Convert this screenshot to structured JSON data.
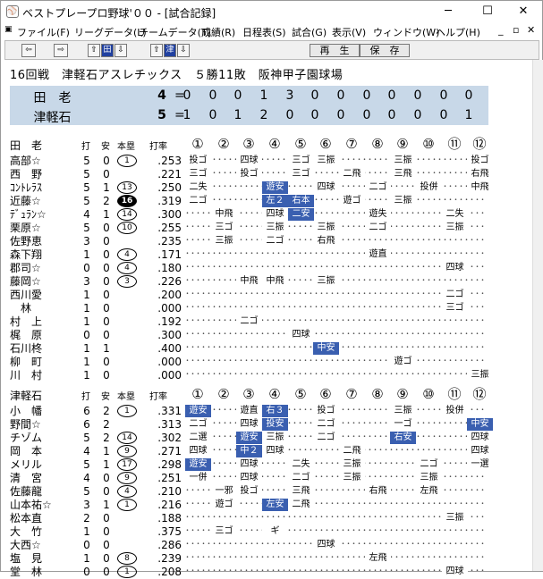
{
  "window": {
    "title": "ベストプレープロ野球'００ - [試合記録]",
    "min": "─",
    "max": "☐",
    "close": "✕",
    "icon": "baseball-icon"
  },
  "menu": {
    "items": [
      "ファイル(F)",
      "リーグデータ(L)",
      "チームデータ(T)",
      "成績(R)",
      "日程表(S)",
      "試合(G)",
      "表示(V)",
      "ウィンドウ(W)",
      "ヘルプ(H)"
    ],
    "mdi": [
      "_",
      "▫",
      "✕"
    ]
  },
  "toolbar": {
    "prev": "⇦",
    "next": "⇨",
    "team_a": "田",
    "team_b": "津",
    "up": "⇧",
    "down": "⇩",
    "replay": "再　生",
    "save": "保　存"
  },
  "game": {
    "title": "16回戦　津軽石アスレチックス　５勝11敗　阪神甲子園球場"
  },
  "scoreboard": {
    "rows": [
      {
        "team": "田　老",
        "total": "4",
        "eq": "=",
        "innings": [
          "0",
          "0",
          "0",
          "1",
          "3",
          "0",
          "0",
          "0",
          "0",
          "0",
          "0",
          "0"
        ]
      },
      {
        "team": "津軽石",
        "total": "5",
        "eq": "=",
        "innings": [
          "1",
          "0",
          "1",
          "2",
          "0",
          "0",
          "0",
          "0",
          "0",
          "0",
          "0",
          "1"
        ]
      }
    ]
  },
  "columns": {
    "ab": "打",
    "h": "安",
    "hr": "本塁",
    "avg": "打率",
    "innings": [
      "①",
      "②",
      "③",
      "④",
      "⑤",
      "⑥",
      "⑦",
      "⑧",
      "⑨",
      "⑩",
      "⑪",
      "⑫"
    ]
  },
  "away": {
    "team": "田　老",
    "players": [
      {
        "name": "高部☆",
        "ab": "5",
        "h": "0",
        "hr": "1",
        "hrs": "c",
        "avg": ".253",
        "pa": [
          [
            0,
            "投ゴ"
          ],
          [
            2,
            "四球"
          ],
          [
            4,
            "三ゴ"
          ],
          [
            5,
            "三振"
          ],
          [
            8,
            "三振"
          ],
          [
            11,
            "投ゴ"
          ]
        ]
      },
      {
        "name": "西　野",
        "ab": "5",
        "h": "0",
        "hr": "",
        "hrs": "",
        "avg": ".221",
        "pa": [
          [
            0,
            "三ゴ"
          ],
          [
            2,
            "投ゴ"
          ],
          [
            4,
            "三ゴ"
          ],
          [
            6,
            "二飛"
          ],
          [
            8,
            "三飛"
          ],
          [
            11,
            "右飛"
          ]
        ]
      },
      {
        "name": "ｺﾝﾄﾚﾗｽ",
        "ab": "5",
        "h": "1",
        "hr": "13",
        "hrs": "c",
        "avg": ".250",
        "pa": [
          [
            0,
            "二失"
          ],
          [
            3,
            "遊安",
            "h"
          ],
          [
            5,
            "四球"
          ],
          [
            7,
            "二ゴ"
          ],
          [
            9,
            "投併"
          ],
          [
            11,
            "中飛"
          ]
        ]
      },
      {
        "name": "近藤☆",
        "ab": "5",
        "h": "2",
        "hr": "16",
        "hrs": "cf",
        "avg": ".319",
        "pa": [
          [
            0,
            "二ゴ"
          ],
          [
            3,
            "左２",
            "h"
          ],
          [
            4,
            "右本",
            "h"
          ],
          [
            6,
            "遊ゴ"
          ],
          [
            8,
            "三振"
          ]
        ]
      },
      {
        "name": "ﾃﾞｭﾗﾝ☆",
        "ab": "4",
        "h": "1",
        "hr": "14",
        "hrs": "c",
        "avg": ".300",
        "pa": [
          [
            1,
            "中飛"
          ],
          [
            3,
            "四球"
          ],
          [
            4,
            "二安",
            "h"
          ],
          [
            7,
            "遊失"
          ],
          [
            10,
            "二失"
          ]
        ]
      },
      {
        "name": "栗原☆",
        "ab": "5",
        "h": "0",
        "hr": "10",
        "hrs": "c",
        "avg": ".255",
        "pa": [
          [
            1,
            "三ゴ"
          ],
          [
            3,
            "三振"
          ],
          [
            5,
            "三振"
          ],
          [
            7,
            "二ゴ"
          ],
          [
            10,
            "三振"
          ]
        ]
      },
      {
        "name": "佐野恵",
        "ab": "3",
        "h": "0",
        "hr": "",
        "hrs": "",
        "avg": ".235",
        "pa": [
          [
            1,
            "三振"
          ],
          [
            3,
            "二ゴ"
          ],
          [
            5,
            "右飛"
          ]
        ]
      },
      {
        "name": "森下翔",
        "ab": "1",
        "h": "0",
        "hr": "4",
        "hrs": "c",
        "avg": ".171",
        "pa": [
          [
            7,
            "遊直"
          ]
        ]
      },
      {
        "name": "郡司☆",
        "ab": "0",
        "h": "0",
        "hr": "4",
        "hrs": "c",
        "avg": ".180",
        "pa": [
          [
            10,
            "四球"
          ]
        ]
      },
      {
        "name": "藤岡☆",
        "ab": "3",
        "h": "0",
        "hr": "3",
        "hrs": "c",
        "avg": ".226",
        "pa": [
          [
            2,
            "中飛"
          ],
          [
            3,
            "中飛"
          ],
          [
            5,
            "三振"
          ]
        ]
      },
      {
        "name": "西川愛",
        "ab": "1",
        "h": "0",
        "hr": "",
        "hrs": "",
        "avg": ".200",
        "pa": [
          [
            10,
            "二ゴ"
          ]
        ]
      },
      {
        "name": "　林",
        "ab": "1",
        "h": "0",
        "hr": "",
        "hrs": "",
        "avg": ".000",
        "pa": [
          [
            10,
            "三ゴ"
          ]
        ]
      },
      {
        "name": "村　上",
        "ab": "1",
        "h": "0",
        "hr": "",
        "hrs": "",
        "avg": ".192",
        "pa": [
          [
            2,
            "二ゴ"
          ]
        ]
      },
      {
        "name": "梶　原",
        "ab": "0",
        "h": "0",
        "hr": "",
        "hrs": "",
        "avg": ".300",
        "pa": [
          [
            4,
            "四球"
          ]
        ]
      },
      {
        "name": "石川柊",
        "ab": "1",
        "h": "1",
        "hr": "",
        "hrs": "",
        "avg": ".400",
        "pa": [
          [
            5,
            "中安",
            "h"
          ]
        ]
      },
      {
        "name": "柳　町",
        "ab": "1",
        "h": "0",
        "hr": "",
        "hrs": "",
        "avg": ".000",
        "pa": [
          [
            8,
            "遊ゴ"
          ]
        ]
      },
      {
        "name": "川　村",
        "ab": "1",
        "h": "0",
        "hr": "",
        "hrs": "",
        "avg": ".000",
        "pa": [
          [
            11,
            "三振"
          ]
        ]
      }
    ]
  },
  "home": {
    "team": "津軽石",
    "players": [
      {
        "name": "小　幡",
        "ab": "6",
        "h": "2",
        "hr": "1",
        "hrs": "c",
        "avg": ".331",
        "pa": [
          [
            0,
            "遊安",
            "h"
          ],
          [
            2,
            "遊直"
          ],
          [
            3,
            "右３",
            "h"
          ],
          [
            5,
            "投ゴ"
          ],
          [
            8,
            "三振"
          ],
          [
            10,
            "投併"
          ]
        ]
      },
      {
        "name": "野間☆",
        "ab": "6",
        "h": "2",
        "hr": "",
        "hrs": "",
        "avg": ".313",
        "pa": [
          [
            0,
            "二ゴ"
          ],
          [
            2,
            "四球"
          ],
          [
            3,
            "投安",
            "h"
          ],
          [
            5,
            "二ゴ"
          ],
          [
            8,
            "一ゴ"
          ],
          [
            11,
            "中安",
            "h"
          ]
        ]
      },
      {
        "name": "チゾム",
        "ab": "5",
        "h": "2",
        "hr": "14",
        "hrs": "c",
        "avg": ".302",
        "pa": [
          [
            0,
            "二選"
          ],
          [
            2,
            "遊安",
            "h"
          ],
          [
            3,
            "三振"
          ],
          [
            5,
            "二ゴ"
          ],
          [
            8,
            "右安",
            "h"
          ],
          [
            11,
            "四球"
          ]
        ]
      },
      {
        "name": "岡　本",
        "ab": "4",
        "h": "1",
        "hr": "9",
        "hrs": "c",
        "avg": ".271",
        "pa": [
          [
            0,
            "四球"
          ],
          [
            2,
            "中２",
            "h"
          ],
          [
            3,
            "四球"
          ],
          [
            6,
            "二飛"
          ],
          [
            11,
            "四球"
          ]
        ]
      },
      {
        "name": "メリル",
        "ab": "5",
        "h": "1",
        "hr": "17",
        "hrs": "c",
        "avg": ".298",
        "pa": [
          [
            0,
            "遊安",
            "h"
          ],
          [
            2,
            "四球"
          ],
          [
            4,
            "二失"
          ],
          [
            6,
            "三振"
          ],
          [
            9,
            "二ゴ"
          ],
          [
            11,
            "一選"
          ]
        ]
      },
      {
        "name": "清　宮",
        "ab": "4",
        "h": "0",
        "hr": "9",
        "hrs": "c",
        "avg": ".251",
        "pa": [
          [
            0,
            "一併"
          ],
          [
            2,
            "四球"
          ],
          [
            4,
            "二ゴ"
          ],
          [
            6,
            "三振"
          ],
          [
            9,
            "三振"
          ]
        ]
      },
      {
        "name": "佐藤龍",
        "ab": "5",
        "h": "0",
        "hr": "4",
        "hrs": "c",
        "avg": ".210",
        "pa": [
          [
            1,
            "一邪"
          ],
          [
            2,
            "投ゴ"
          ],
          [
            4,
            "三飛"
          ],
          [
            7,
            "右飛"
          ],
          [
            9,
            "左飛"
          ]
        ]
      },
      {
        "name": "山本祐☆",
        "ab": "3",
        "h": "1",
        "hr": "1",
        "hrs": "c",
        "avg": ".216",
        "pa": [
          [
            1,
            "遊ゴ"
          ],
          [
            3,
            "左安",
            "h"
          ],
          [
            4,
            "二飛"
          ]
        ]
      },
      {
        "name": "松本直",
        "ab": "2",
        "h": "0",
        "hr": "",
        "hrs": "",
        "avg": ".188",
        "pa": [
          [
            10,
            "三振"
          ]
        ]
      },
      {
        "name": "大　竹",
        "ab": "1",
        "h": "0",
        "hr": "",
        "hrs": "",
        "avg": ".375",
        "pa": [
          [
            1,
            "三ゴ"
          ],
          [
            3,
            "ギ"
          ]
        ]
      },
      {
        "name": "大西☆",
        "ab": "0",
        "h": "0",
        "hr": "",
        "hrs": "",
        "avg": ".286",
        "pa": [
          [
            5,
            "四球"
          ]
        ]
      },
      {
        "name": "塩　見",
        "ab": "1",
        "h": "0",
        "hr": "8",
        "hrs": "c",
        "avg": ".239",
        "pa": [
          [
            7,
            "左飛"
          ]
        ]
      },
      {
        "name": "堂　林",
        "ab": "0",
        "h": "0",
        "hr": "1",
        "hrs": "c",
        "avg": ".208",
        "pa": [
          [
            10,
            "四球"
          ]
        ]
      }
    ]
  }
}
